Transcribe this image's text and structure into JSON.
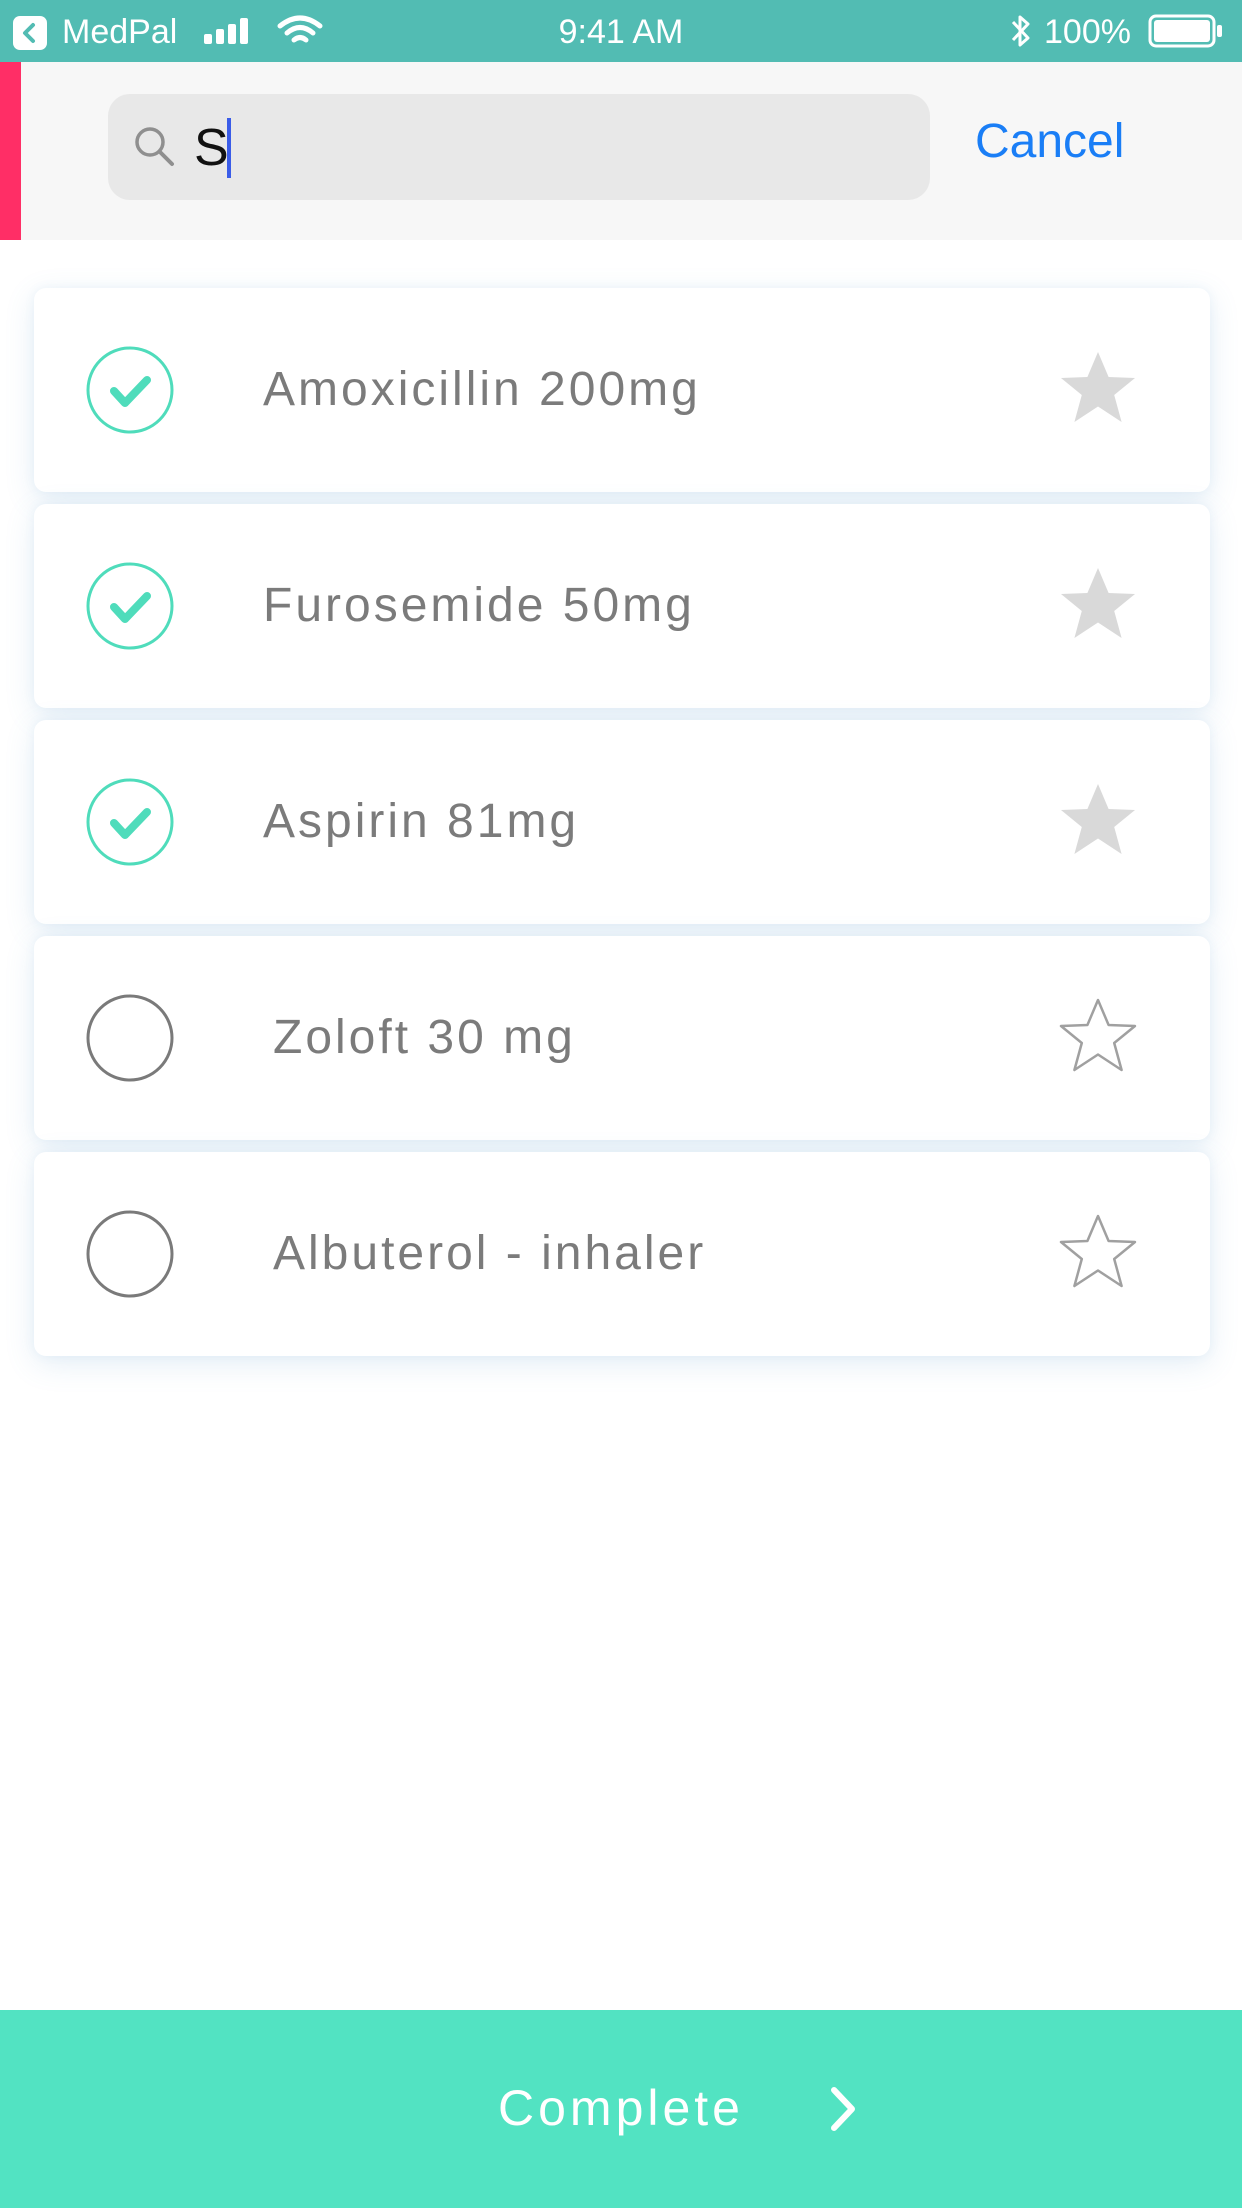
{
  "status_bar": {
    "carrier": "MedPal",
    "time": "9:41 AM",
    "battery": "100%"
  },
  "search": {
    "value": "S",
    "cancel_label": "Cancel"
  },
  "medications": [
    {
      "name": "Amoxicillin 200mg",
      "checked": true,
      "favorite": true
    },
    {
      "name": "Furosemide 50mg",
      "checked": true,
      "favorite": true
    },
    {
      "name": "Aspirin 81mg",
      "checked": true,
      "favorite": true
    },
    {
      "name": "Zoloft 30 mg",
      "checked": false,
      "favorite": false
    },
    {
      "name": "Albuterol - inhaler",
      "checked": false,
      "favorite": false
    }
  ],
  "footer": {
    "complete_label": "Complete"
  },
  "colors": {
    "status_bar": "#52bcb3",
    "accent": "#52e3c2",
    "check": "#4fdcbb",
    "cancel": "#1a7ef6",
    "strip": "#ff2e66"
  }
}
